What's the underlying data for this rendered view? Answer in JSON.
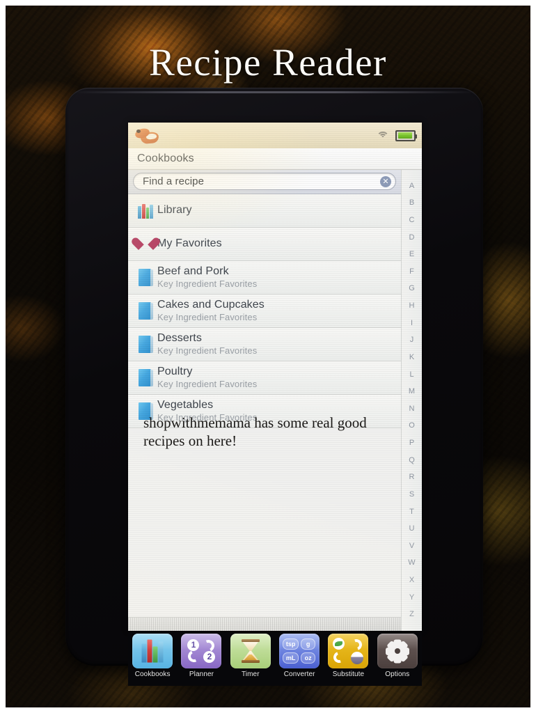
{
  "title": "Recipe Reader",
  "caption": "shopwithmemama has some real good recipes on here!",
  "device": {
    "statusbar": {
      "app_logo": "cooking-pot-logo",
      "wifi": "wifi-icon",
      "battery": "battery-icon"
    },
    "navbar": {
      "title": "Cookbooks"
    },
    "search": {
      "placeholder": "Find a recipe",
      "clear": "✕"
    },
    "shortcuts": [
      {
        "label": "Library",
        "icon": "library-books-icon"
      },
      {
        "label": "My Favorites",
        "icon": "heart-icon"
      }
    ],
    "cookbooks": [
      {
        "title": "Beef and Pork",
        "subtitle": "Key Ingredient Favorites",
        "icon": "book-icon"
      },
      {
        "title": "Cakes and Cupcakes",
        "subtitle": "Key Ingredient Favorites",
        "icon": "book-icon"
      },
      {
        "title": "Desserts",
        "subtitle": "Key Ingredient Favorites",
        "icon": "book-icon"
      },
      {
        "title": "Poultry",
        "subtitle": "Key Ingredient Favorites",
        "icon": "book-icon"
      },
      {
        "title": "Vegetables",
        "subtitle": "Key Ingredient Favorites",
        "icon": "book-icon"
      }
    ],
    "alphabet_index": [
      "A",
      "B",
      "C",
      "D",
      "E",
      "F",
      "G",
      "H",
      "I",
      "J",
      "K",
      "L",
      "M",
      "N",
      "O",
      "P",
      "Q",
      "R",
      "S",
      "T",
      "U",
      "V",
      "W",
      "X",
      "Y",
      "Z"
    ],
    "dock": [
      {
        "label": "Cookbooks",
        "icon": "books-icon",
        "color": "#57b3e2"
      },
      {
        "label": "Planner",
        "icon": "recycle-1-2-icon",
        "color": "#8867c4",
        "badge_one": "1",
        "badge_two": "2"
      },
      {
        "label": "Timer",
        "icon": "hourglass-icon",
        "color": "#a8cf79"
      },
      {
        "label": "Converter",
        "icon": "units-icon",
        "color": "#4a5fd0",
        "units": [
          "tsp",
          "g",
          "mL",
          "oz"
        ]
      },
      {
        "label": "Substitute",
        "icon": "swap-icon",
        "color": "#d9a406"
      },
      {
        "label": "Options",
        "icon": "gear-icon",
        "color": "#4b3f3d"
      }
    ]
  }
}
